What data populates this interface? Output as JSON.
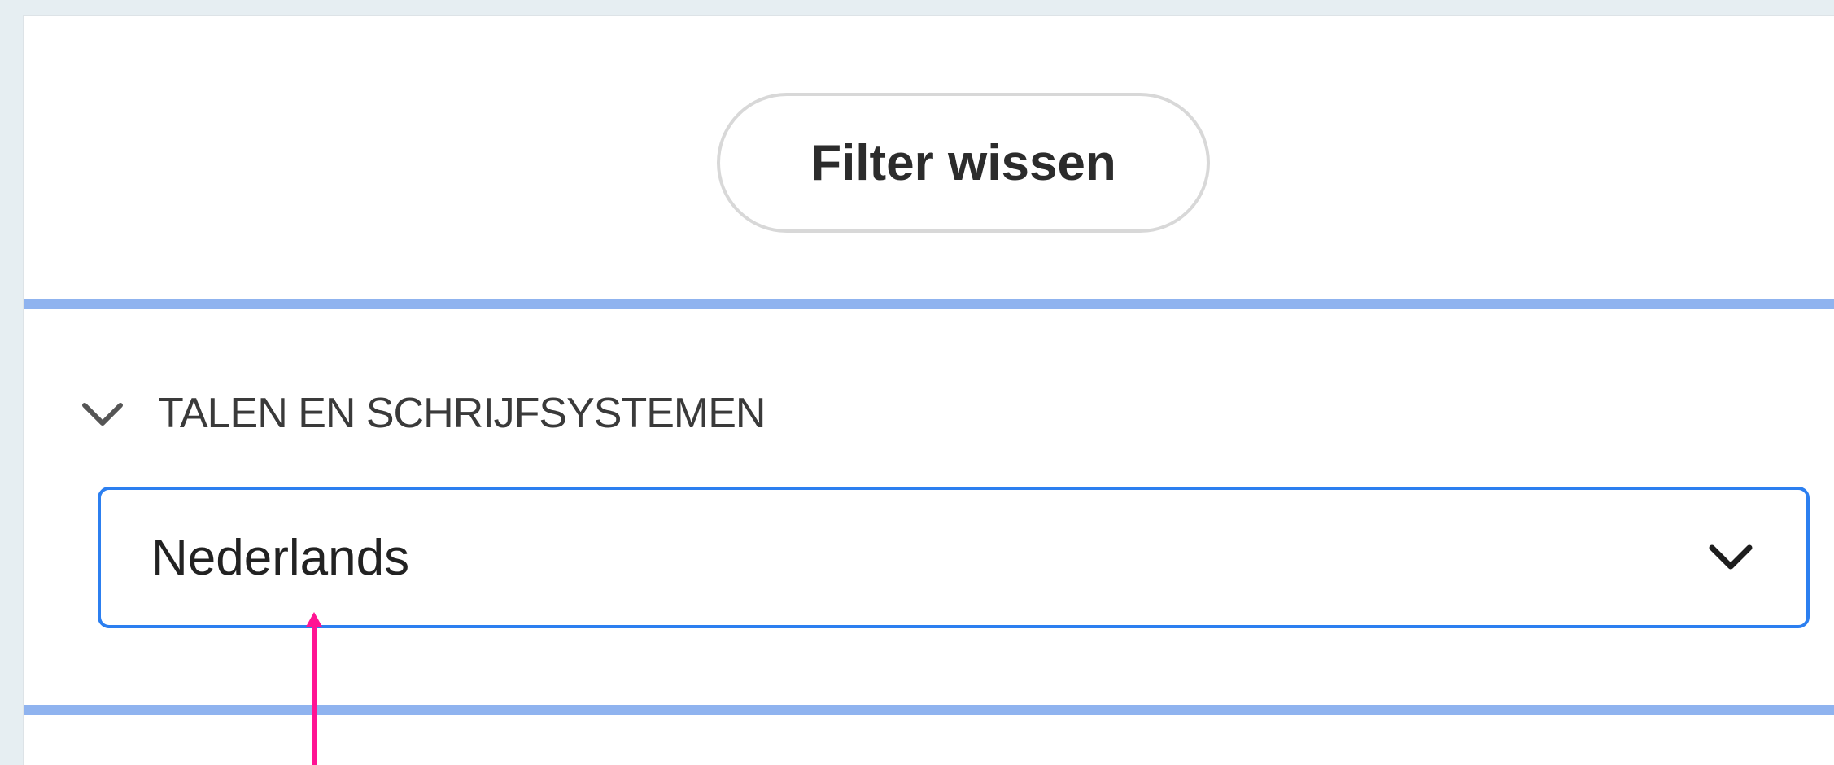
{
  "filter": {
    "clear_label": "Filter wissen"
  },
  "section": {
    "title": "TALEN EN SCHRIJFSYSTEMEN",
    "toggle_icon": "chevron-down-icon"
  },
  "language_select": {
    "value": "Nederlands",
    "icon": "chevron-down-icon"
  },
  "colors": {
    "accent": "#2c7ff0",
    "divider": "#8fb3ef",
    "annotation": "#ff1493"
  }
}
